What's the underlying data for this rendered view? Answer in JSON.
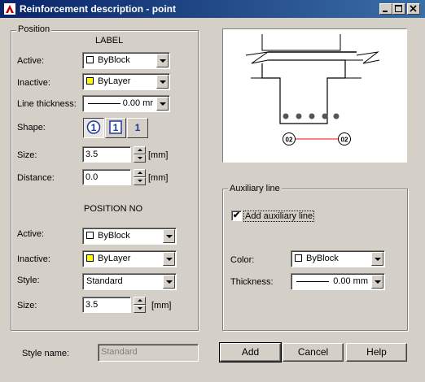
{
  "window": {
    "title": "Reinforcement description - point",
    "icon": "app-icon"
  },
  "position": {
    "legend": "Position",
    "label_header": "LABEL",
    "active_label": "Active:",
    "active_value": "ByBlock",
    "active_color": "#ffffff",
    "inactive_label": "Inactive:",
    "inactive_value": "ByLayer",
    "inactive_color": "#ffff00",
    "line_thickness_label": "Line thickness:",
    "line_thickness_value": "0.00 mr",
    "shape_label": "Shape:",
    "shape_options": [
      "1",
      "1",
      "1"
    ],
    "size_label": "Size:",
    "size_value": "3.5",
    "size_unit": "[mm]",
    "distance_label": "Distance:",
    "distance_value": "0.0",
    "distance_unit": "[mm]",
    "posno_header": "POSITION NO",
    "posno_active_label": "Active:",
    "posno_active_value": "ByBlock",
    "posno_inactive_label": "Inactive:",
    "posno_inactive_value": "ByLayer",
    "style_label": "Style:",
    "style_value": "Standard",
    "posno_size_label": "Size:",
    "posno_size_value": "3.5",
    "posno_size_unit": "[mm]"
  },
  "preview": {
    "marker_left": "02",
    "marker_right": "02",
    "line_color": "#ff0000"
  },
  "auxiliary": {
    "legend": "Auxiliary line",
    "add_label": "Add auxiliary line",
    "add_checked": true,
    "color_label": "Color:",
    "color_value": "ByBlock",
    "thickness_label": "Thickness:",
    "thickness_value": "0.00 mm"
  },
  "footer": {
    "style_name_label": "Style name:",
    "style_name_value": "Standard",
    "add_button": "Add",
    "cancel_button": "Cancel",
    "help_button": "Help"
  }
}
